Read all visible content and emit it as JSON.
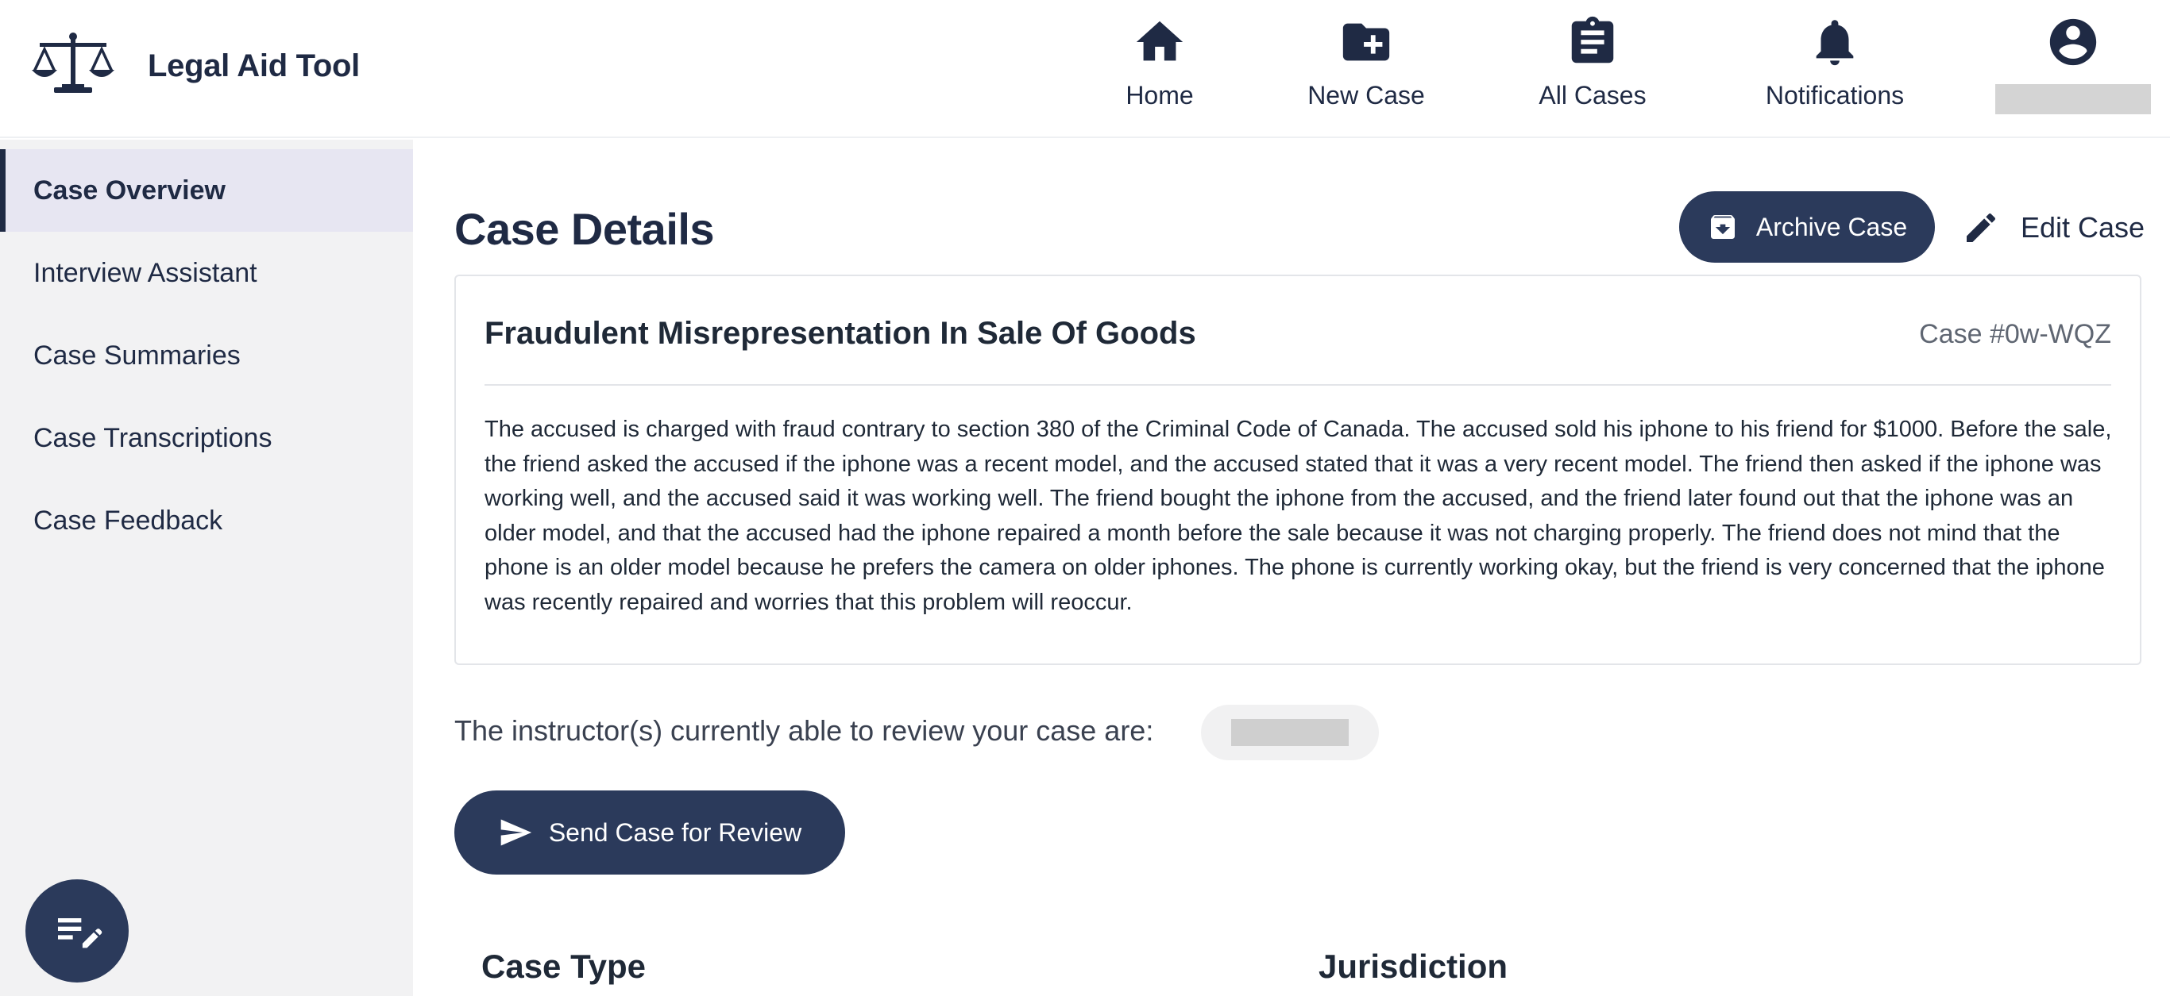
{
  "app": {
    "name": "Legal Aid Tool",
    "logo_icon": "scales-of-justice-icon"
  },
  "nav": [
    {
      "label": "Home",
      "icon": "home-icon"
    },
    {
      "label": "New Case",
      "icon": "folder-plus-icon"
    },
    {
      "label": "All Cases",
      "icon": "clipboard-list-icon"
    },
    {
      "label": "Notifications",
      "icon": "bell-icon"
    },
    {
      "label": "",
      "icon": "account-circle-icon"
    }
  ],
  "sidebar": {
    "items": [
      {
        "label": "Case Overview",
        "active": true
      },
      {
        "label": "Interview Assistant",
        "active": false
      },
      {
        "label": "Case Summaries",
        "active": false
      },
      {
        "label": "Case Transcriptions",
        "active": false
      },
      {
        "label": "Case Feedback",
        "active": false
      }
    ],
    "fab_icon": "notes-edit-icon"
  },
  "main": {
    "title": "Case Details",
    "archive_label": "Archive Case",
    "edit_label": "Edit Case",
    "case": {
      "name": "Fraudulent Misrepresentation In Sale Of Goods",
      "number": "Case #0w-WQZ",
      "description": "The accused is charged with fraud contrary to section 380 of the Criminal Code of Canada. The accused sold his iphone to his friend for $1000. Before the sale, the friend asked the accused if the iphone was a recent model, and the accused stated that it was a very recent model. The friend then asked if the iphone was working well, and the accused said it was working well. The friend bought the iphone from the accused, and the friend later found out that the iphone was an older model, and that the accused had the iphone repaired a month before the sale because it was not charging properly. The friend does not mind that the phone is an older model because he prefers the camera on older iphones. The phone is currently working okay, but the friend is very concerned that the iphone was recently repaired and worries that this problem will reoccur."
    },
    "instructor_text": "The instructor(s) currently able to review your case are:",
    "send_label": "Send Case for Review",
    "sections": {
      "case_type": "Case Type",
      "jurisdiction": "Jurisdiction"
    }
  },
  "colors": {
    "primary": "#2b3a5b",
    "text": "#1f2a44",
    "sidebar_bg": "#f2f2f3",
    "active_item_bg": "#e7e6f2"
  }
}
